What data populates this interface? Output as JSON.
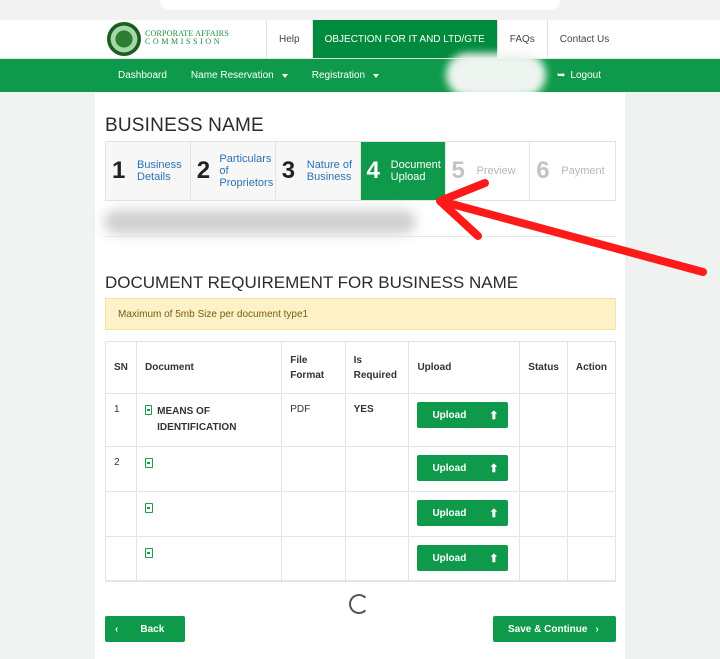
{
  "brand": {
    "line1": "CORPORATE AFFAIRS",
    "line2": "COMMISSION"
  },
  "topnav": {
    "help": "Help",
    "objection": "OBJECTION FOR IT AND LTD/GTE",
    "faqs": "FAQs",
    "contact": "Contact Us"
  },
  "mainnav": {
    "dashboard": "Dashboard",
    "name_reservation": "Name Reservation",
    "registration": "Registration",
    "logout": "Logout"
  },
  "page_title": "BUSINESS NAME",
  "steps": [
    {
      "num": "1",
      "label": "Business Details",
      "state": "done"
    },
    {
      "num": "2",
      "label": "Particulars of Proprietors",
      "state": "done"
    },
    {
      "num": "3",
      "label": "Nature of Business",
      "state": "done"
    },
    {
      "num": "4",
      "label": "Document Upload",
      "state": "active"
    },
    {
      "num": "5",
      "label": "Preview",
      "state": "disabled"
    },
    {
      "num": "6",
      "label": "Payment",
      "state": "disabled"
    }
  ],
  "section_title": "DOCUMENT REQUIREMENT FOR BUSINESS NAME",
  "notice": "Maximum of 5mb Size per document type1",
  "table": {
    "headers": {
      "sn": "SN",
      "document": "Document",
      "format": "File Format",
      "required": "Is Required",
      "upload": "Upload",
      "status": "Status",
      "action": "Action"
    },
    "rows": [
      {
        "sn": "1",
        "document": "MEANS OF IDENTIFICATION",
        "format": "PDF",
        "required": "YES",
        "upload": "Upload"
      },
      {
        "sn": "2",
        "document": "",
        "format": "",
        "required": "",
        "upload": "Upload"
      },
      {
        "sn": "",
        "document": "",
        "format": "",
        "required": "",
        "upload": "Upload"
      },
      {
        "sn": "",
        "document": "",
        "format": "",
        "required": "",
        "upload": "Upload"
      }
    ]
  },
  "buttons": {
    "back": "Back",
    "save_continue": "Save & Continue"
  },
  "colors": {
    "primary_green": "#0e9a4a",
    "annotation_arrow": "#ff1a1a"
  }
}
